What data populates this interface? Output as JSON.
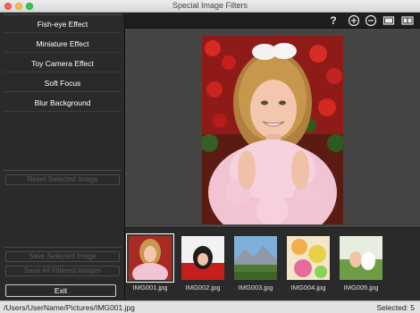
{
  "window": {
    "title": "Special Image Filters"
  },
  "effects": [
    {
      "label": "Fish-eye Effect"
    },
    {
      "label": "Miniature Effect"
    },
    {
      "label": "Toy Camera Effect"
    },
    {
      "label": "Soft Focus"
    },
    {
      "label": "Blur Background"
    }
  ],
  "buttons": {
    "reset": "Reset Selected Image",
    "save_selected": "Save Selected Image",
    "save_all": "Save All Filtered Images",
    "exit": "Exit"
  },
  "toolbar": {
    "icons": [
      "help-icon",
      "zoom-in-icon",
      "zoom-out-icon",
      "full-screen-icon",
      "compare-icon"
    ],
    "help_glyph": "?"
  },
  "thumbnails": [
    {
      "name": "IMG001.jpg",
      "selected": true
    },
    {
      "name": "IMG002.jpg",
      "selected": false
    },
    {
      "name": "IMG003.jpg",
      "selected": false
    },
    {
      "name": "IMG004.jpg",
      "selected": false
    },
    {
      "name": "IMG005.jpg",
      "selected": false
    }
  ],
  "status": {
    "path": "/Users/UserName/Pictures/IMG001.jpg",
    "selected": "Selected: 5"
  },
  "colors": {
    "panel_bg": "#2a2a2a",
    "preview_bg": "#454545",
    "disabled_text": "#5c5c5c"
  }
}
